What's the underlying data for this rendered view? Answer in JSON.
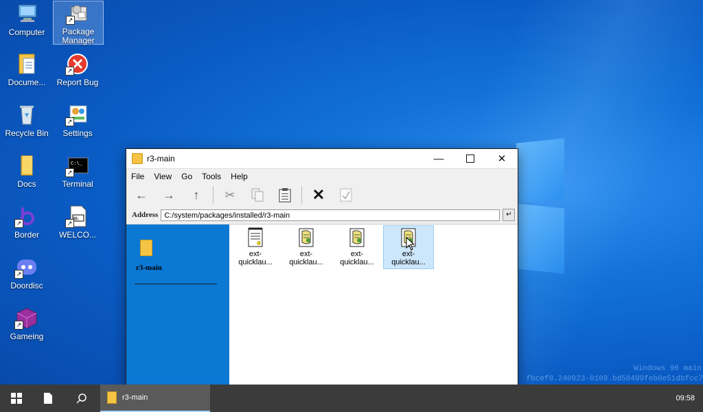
{
  "desktop": {
    "icons": [
      {
        "label": "Computer",
        "icon": "computer-icon"
      },
      {
        "label": "Package Manager",
        "icon": "package-manager-icon"
      },
      {
        "label": "Docume...",
        "icon": "documents-icon"
      },
      {
        "label": "Report Bug",
        "icon": "report-bug-icon"
      },
      {
        "label": "Recycle Bin",
        "icon": "recycle-bin-icon"
      },
      {
        "label": "Settings",
        "icon": "settings-icon"
      },
      {
        "label": "Docs",
        "icon": "folder-icon"
      },
      {
        "label": "Terminal",
        "icon": "terminal-icon"
      },
      {
        "label": "Border",
        "icon": "border-icon"
      },
      {
        "label": "WELCO...",
        "icon": "markdown-file-icon"
      },
      {
        "label": "Doordisc",
        "icon": "doordisc-icon"
      },
      {
        "label": "Gameing",
        "icon": "gameing-icon"
      }
    ],
    "watermark": {
      "line1": "Windows 96 main",
      "line2": "fbcef0.240923-0109.bd50499feb0e51dbfcc7"
    }
  },
  "window": {
    "title": "r3-main",
    "menu": [
      "File",
      "View",
      "Go",
      "Tools",
      "Help"
    ],
    "address_label": "Address",
    "address_value": "C:/system/packages/installed/r3-main",
    "sidebar_folder_name": "r3-main",
    "files": [
      {
        "line1": "ext-",
        "line2": "quicklau..."
      },
      {
        "line1": "ext-",
        "line2": "quicklau..."
      },
      {
        "line1": "ext-",
        "line2": "quicklau..."
      },
      {
        "line1": "ext-",
        "line2": "quicklau..."
      }
    ]
  },
  "taskbar": {
    "task_label": "r3-main",
    "clock": "09:58"
  },
  "colors": {
    "desktop_blue": "#0a5bc4",
    "sidepane_blue": "#0b78d4",
    "taskbar": "#3b3b3b"
  }
}
